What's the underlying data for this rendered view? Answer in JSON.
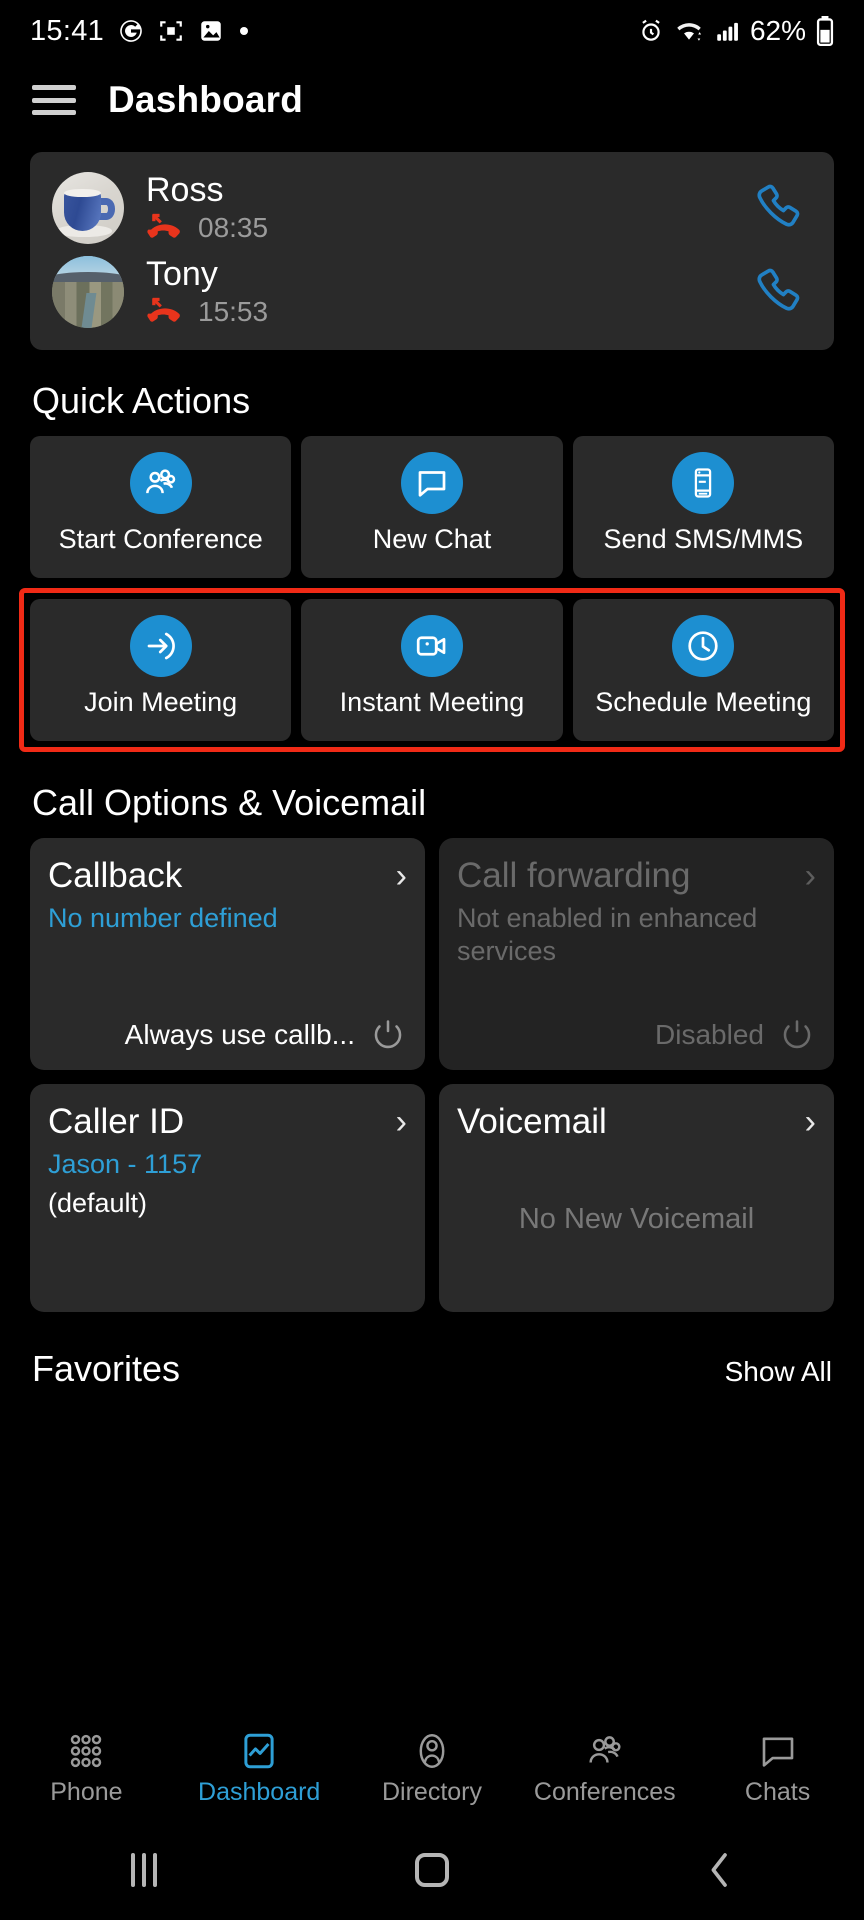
{
  "status_bar": {
    "time": "15:41",
    "battery_text": "62%",
    "left_icons": [
      "g-app-icon",
      "screenshot-capture-icon",
      "image-icon",
      "dot-icon"
    ],
    "right_icons": [
      "alarm-icon",
      "wifi-icon",
      "signal-icon",
      "battery-icon"
    ]
  },
  "app_bar": {
    "menu_icon": "hamburger-menu-icon",
    "title": "Dashboard"
  },
  "recent_calls": [
    {
      "name": "Ross",
      "time": "08:35",
      "status_icon": "missed-call-icon",
      "avatar": "coffee-mug-photo",
      "action_icon": "phone-call-icon"
    },
    {
      "name": "Tony",
      "time": "15:53",
      "status_icon": "missed-call-icon",
      "avatar": "cityscape-photo",
      "action_icon": "phone-call-icon"
    }
  ],
  "quick_actions": {
    "heading": "Quick Actions",
    "rows": [
      {
        "highlighted": false,
        "tiles": [
          {
            "label": "Start Conference",
            "icon": "group-people-icon"
          },
          {
            "label": "New Chat",
            "icon": "chat-bubble-icon"
          },
          {
            "label": "Send SMS/MMS",
            "icon": "mobile-phone-icon"
          }
        ]
      },
      {
        "highlighted": true,
        "tiles": [
          {
            "label": "Join Meeting",
            "icon": "arrow-enter-icon"
          },
          {
            "label": "Instant Meeting",
            "icon": "video-camera-icon"
          },
          {
            "label": "Schedule Meeting",
            "icon": "clock-icon"
          }
        ]
      }
    ]
  },
  "call_options": {
    "heading": "Call Options & Voicemail",
    "callback": {
      "title": "Callback",
      "subtitle": "No number defined",
      "footer_text": "Always use callb...",
      "footer_icon": "power-toggle-icon",
      "chevron": "›",
      "disabled": false
    },
    "call_forwarding": {
      "title": "Call forwarding",
      "subtitle": "Not enabled in enhanced services",
      "footer_text": "Disabled",
      "footer_icon": "power-toggle-icon",
      "chevron": "›",
      "disabled": true
    },
    "caller_id": {
      "title": "Caller ID",
      "subtitle": "Jason - 1157",
      "subtitle2": "(default)",
      "chevron": "›",
      "disabled": false
    },
    "voicemail": {
      "title": "Voicemail",
      "empty_text": "No New Voicemail",
      "chevron": "›",
      "disabled": false
    }
  },
  "favorites": {
    "heading": "Favorites",
    "show_all": "Show All"
  },
  "bottom_nav": {
    "items": [
      {
        "label": "Phone",
        "icon": "dialpad-icon",
        "active": false
      },
      {
        "label": "Dashboard",
        "icon": "chart-icon",
        "active": true
      },
      {
        "label": "Directory",
        "icon": "person-icon",
        "active": false
      },
      {
        "label": "Conferences",
        "icon": "group-icon",
        "active": false
      },
      {
        "label": "Chats",
        "icon": "chat-bubble-icon",
        "active": false
      }
    ]
  },
  "android_nav": {
    "recents_icon": "recents-icon",
    "home_icon": "home-icon",
    "back_icon": "back-icon"
  },
  "colors": {
    "accent": "#1d8fd1",
    "link": "#2e9fd6",
    "highlight_border": "#f02a16",
    "missed_call": "#e8341c",
    "card_bg": "#2a2a2a",
    "page_bg": "#000000"
  }
}
